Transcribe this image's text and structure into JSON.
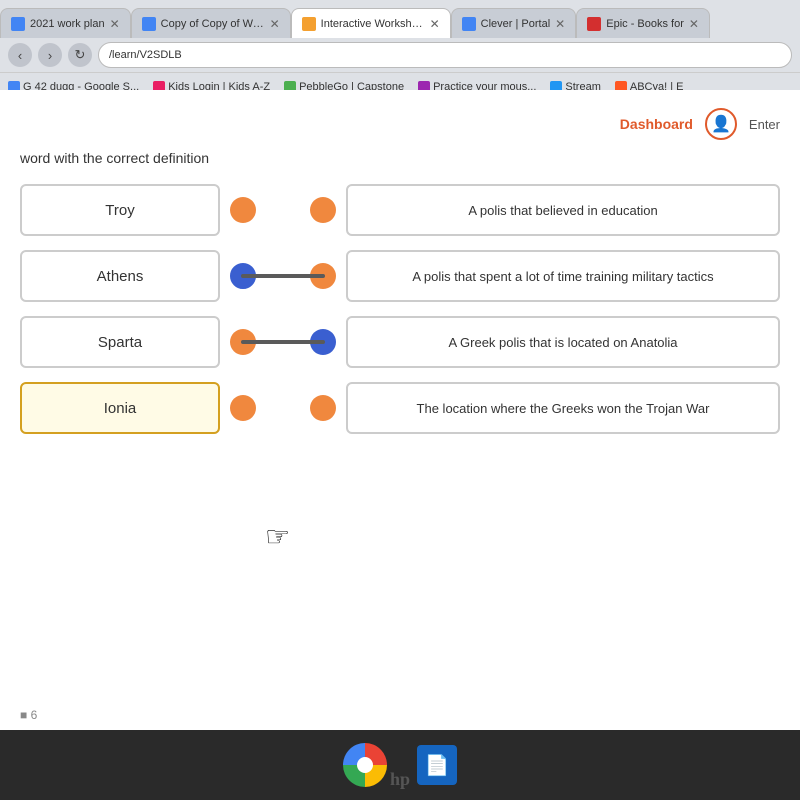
{
  "browser": {
    "tabs": [
      {
        "id": "tab1",
        "label": "2021 work plan",
        "active": false,
        "favicon_color": "#4285f4"
      },
      {
        "id": "tab2",
        "label": "Copy of Copy of Work",
        "active": false,
        "favicon_color": "#2196f3"
      },
      {
        "id": "tab3",
        "label": "Interactive Worksheets",
        "active": true,
        "favicon_color": "#f4a030"
      },
      {
        "id": "tab4",
        "label": "Clever | Portal",
        "active": false,
        "favicon_color": "#2196f3"
      },
      {
        "id": "tab5",
        "label": "Epic - Books for",
        "active": false,
        "favicon_color": "#d32f2f"
      }
    ],
    "address": "/learn/V2SDLB",
    "bookmarks": [
      {
        "label": "G 42 dugg - Google S..."
      },
      {
        "label": "Kids Login | Kids A-Z"
      },
      {
        "label": "PebbleGo | Capstone"
      },
      {
        "label": "Practice your mous..."
      },
      {
        "label": "Stream"
      },
      {
        "label": "ABCya! | E"
      }
    ]
  },
  "page": {
    "dashboard_label": "Dashboard",
    "enter_label": "Enter",
    "instruction": "word with the correct definition",
    "terms": [
      {
        "id": "troy",
        "label": "Troy",
        "dot_active": false
      },
      {
        "id": "athens",
        "label": "Athens",
        "dot_active": true
      },
      {
        "id": "sparta",
        "label": "Sparta",
        "dot_active": false
      },
      {
        "id": "ionia",
        "label": "Ionia",
        "dot_active": false
      }
    ],
    "definitions": [
      {
        "id": "def1",
        "text": "A polis that believed in education",
        "dot_active": false
      },
      {
        "id": "def2",
        "text": "A polis that spent a lot of time training military tactics",
        "dot_active": false
      },
      {
        "id": "def3",
        "text": "A Greek polis that is located on Anatolia",
        "dot_active": true
      },
      {
        "id": "def4",
        "text": "The location where the Greeks won the Trojan War",
        "dot_active": false
      }
    ],
    "connections": [
      {
        "from": "athens",
        "to": "def2"
      },
      {
        "from": "sparta",
        "to": "def3"
      }
    ],
    "page_number": "6"
  },
  "taskbar": {
    "chrome_icon": "⊙",
    "files_icon": "📄"
  }
}
